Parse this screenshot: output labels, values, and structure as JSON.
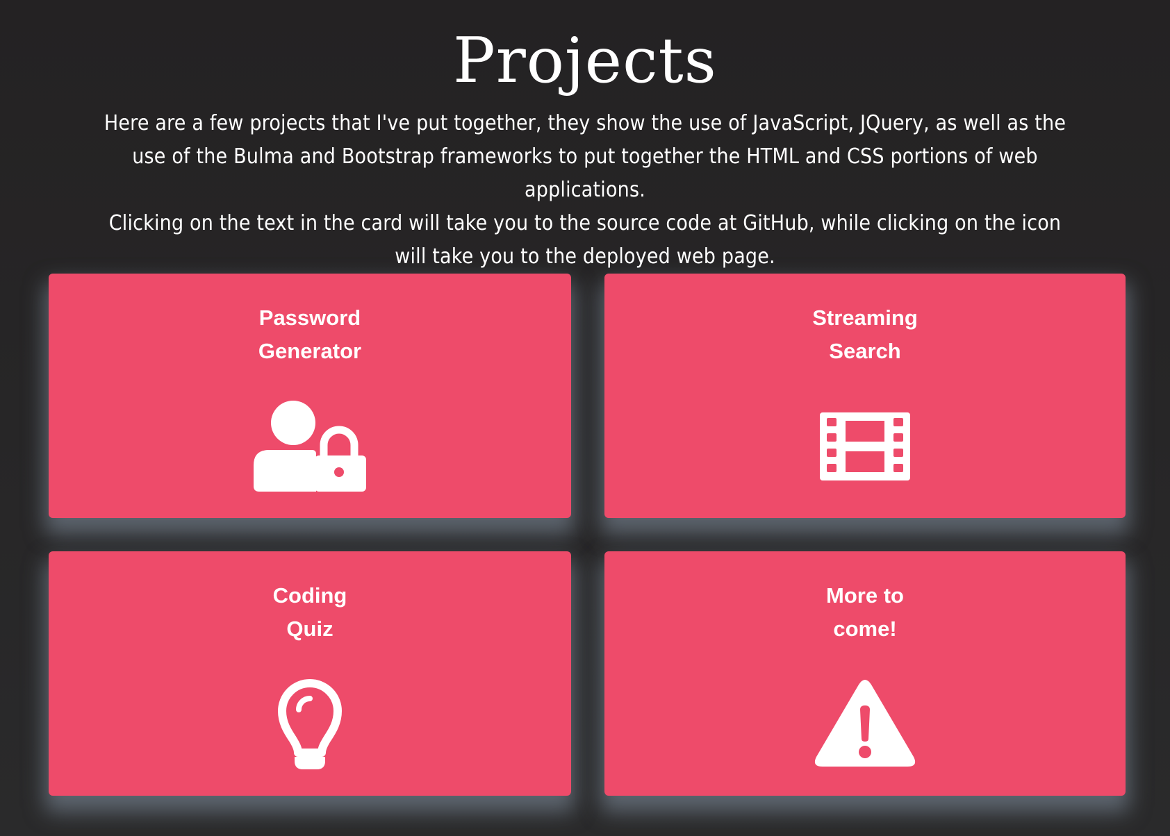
{
  "header": {
    "title": "Projects",
    "intro_line1": "Here are a few projects that I've put together, they show the use of JavaScript, JQuery, as well as the use of the Bulma and Bootstrap frameworks to put together the HTML and CSS portions of web applications.",
    "intro_line2": "Clicking on the text in the card will take you to the source code at GitHub, while clicking on the icon will take you to the deployed web page."
  },
  "colors": {
    "background": "#262526",
    "card": "#ee4b6a",
    "text": "#ffffff"
  },
  "cards": [
    {
      "title_line1": "Password",
      "title_line2": "Generator",
      "icon": "user-lock-icon"
    },
    {
      "title_line1": "Streaming",
      "title_line2": "Search",
      "icon": "film-icon"
    },
    {
      "title_line1": "Coding",
      "title_line2": "Quiz",
      "icon": "lightbulb-icon"
    },
    {
      "title_line1": "More to",
      "title_line2": "come!",
      "icon": "warning-triangle-icon"
    }
  ]
}
